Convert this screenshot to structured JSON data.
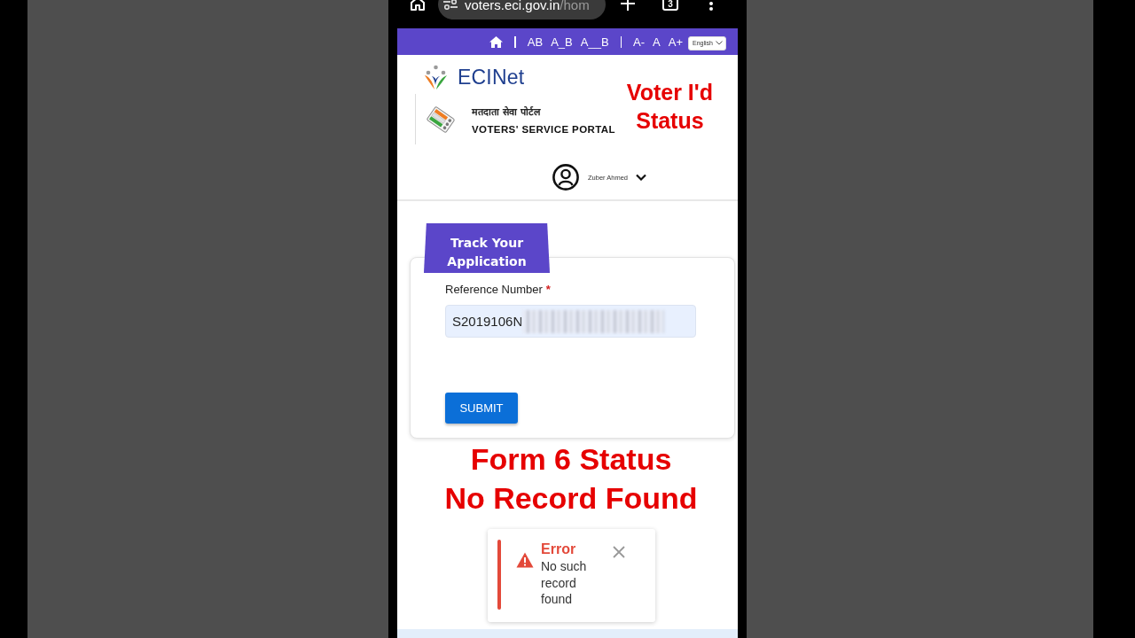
{
  "browser": {
    "url_host": "voters.eci.gov.in",
    "url_path": "/hom",
    "tab_count": "3"
  },
  "nav_bar": {
    "items": [
      {
        "kind": "home"
      },
      {
        "kind": "divider"
      },
      {
        "kind": "text",
        "label": "AB"
      },
      {
        "kind": "text",
        "label": "A_B"
      },
      {
        "kind": "text",
        "label": "A__B"
      },
      {
        "kind": "divider"
      },
      {
        "kind": "text",
        "label": "A-"
      },
      {
        "kind": "text",
        "label": "A"
      },
      {
        "kind": "text",
        "label": "A+"
      }
    ],
    "language": "English"
  },
  "header": {
    "brand": "ECINet",
    "portal_hindi": "मतदाता सेवा पोर्टल",
    "portal_english": "VOTERS' SERVICE PORTAL",
    "overlay_title": [
      "Voter I'd",
      "Status"
    ],
    "user": {
      "name": "Zuber Ahmed"
    }
  },
  "tab": {
    "label": "Track Your Application"
  },
  "form": {
    "field": {
      "label": "Reference Number",
      "required_mark": "*",
      "value": "S2019106N",
      "redacted": true
    },
    "submit": "SUBMIT"
  },
  "caption": [
    "Form 6 Status",
    "No Record Found"
  ],
  "toast": {
    "kind": "error",
    "title": "Error",
    "message": "No such record found"
  }
}
